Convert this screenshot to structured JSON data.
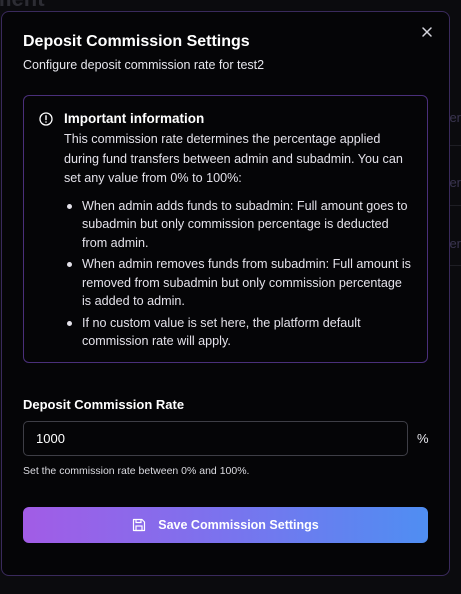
{
  "background": {
    "title_fragment": "ment",
    "side_fragments": [
      "er",
      "er",
      "er"
    ]
  },
  "modal": {
    "title": "Deposit Commission Settings",
    "subtitle": "Configure deposit commission rate for test2",
    "close_icon": "close-icon"
  },
  "info": {
    "icon": "alert-circle-icon",
    "heading": "Important information",
    "body": "This commission rate determines the percentage applied during fund transfers between admin and subadmin. You can set any value from 0% to 100%:",
    "bullets": [
      "When admin adds funds to subadmin: Full amount goes to subadmin but only commission percentage is deducted from admin.",
      "When admin removes funds from subadmin: Full amount is removed from subadmin but only commission percentage is added to admin.",
      "If no custom value is set here, the platform default commission rate will apply."
    ]
  },
  "form": {
    "label": "Deposit Commission Rate",
    "value": "1000",
    "unit": "%",
    "hint": "Set the commission rate between 0% and 100%."
  },
  "save_button": {
    "label": "Save Commission Settings",
    "icon": "save-icon"
  },
  "colors": {
    "accent_start": "#a25ce6",
    "accent_end": "#4f8ef2",
    "border_purple": "#4a2f7a"
  }
}
